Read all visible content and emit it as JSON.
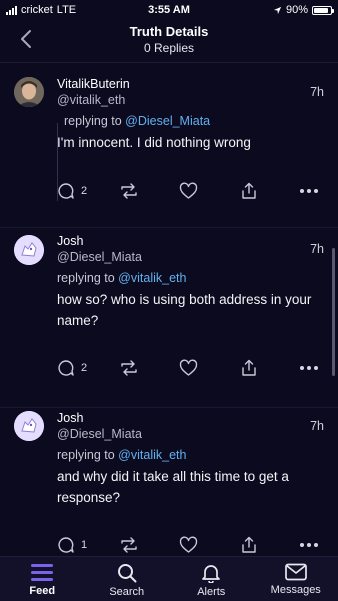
{
  "status_bar": {
    "carrier": "cricket",
    "network": "LTE",
    "time": "3:55 AM",
    "battery": "90%",
    "battery_level": 0.9
  },
  "header": {
    "title": "Truth Details",
    "subtitle": "0 Replies"
  },
  "posts": [
    {
      "display_name": "VitalikButerin",
      "handle": "@vitalik_eth",
      "time": "7h",
      "replying_prefix": "replying to",
      "replying_to": "@Diesel_Miata",
      "text": "I'm innocent. I did nothing wrong",
      "reply_count": "2"
    },
    {
      "display_name": "Josh",
      "handle": "@Diesel_Miata",
      "time": "7h",
      "replying_prefix": "replying to",
      "replying_to": "@vitalik_eth",
      "text": "how so? who is using both address in your name?",
      "reply_count": "2"
    },
    {
      "display_name": "Josh",
      "handle": "@Diesel_Miata",
      "time": "7h",
      "replying_prefix": "replying to",
      "replying_to": "@vitalik_eth",
      "text": "and why did it take all this time to get a response?",
      "reply_count": "1"
    }
  ],
  "tabs": [
    {
      "label": "Feed",
      "active": true
    },
    {
      "label": "Search",
      "active": false
    },
    {
      "label": "Alerts",
      "active": false
    },
    {
      "label": "Messages",
      "active": false
    }
  ],
  "colors": {
    "background": "#0c0a1e",
    "mention": "#62b0f0",
    "active_tab": "#7a63e8",
    "tabbar": "#13112a"
  }
}
